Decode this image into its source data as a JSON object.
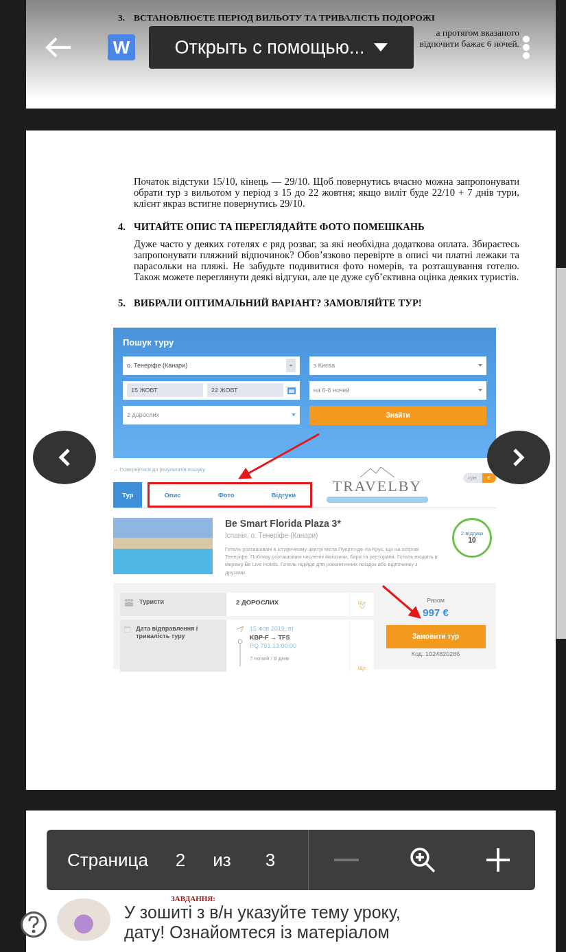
{
  "toolbar": {
    "app_letter": "W",
    "title": "Открыть с помощью..."
  },
  "previous_page": {
    "number": "3.",
    "heading": "ВСТАНОВЛЮЄТЕ ПЕРІОД ВИЛЬОТУ ТА ТРИВАЛІСТЬ ПОДОРОЖІ",
    "fragments": [
      "а протягом вказаного",
      "відпочити  бажає 6 ночей."
    ]
  },
  "document_page": {
    "paragraph": "Початок відстуки 15/10, кінець — 29/10. Щоб повернутись вчасно можна запропонувати обрати тур з вильотом у період з 15 до 22 жовтня; якщо виліт буде 22/10 + 7 днів тури, клієнт якраз встигне повернутись 29/10.",
    "sections": [
      {
        "number": "4.",
        "heading": "ЧИТАЙТЕ ОПИС ТА ПЕРЕГЛЯДАЙТЕ ФОТО ПОМЕШКАНЬ",
        "body": "Дуже часто у деяких готелях є ряд розваг, за які необхідна додаткова оплата. Збираєтесь запропонувати пляжний відпочинок? Обов’язково перевірте в описі чи платні лежаки та парасольки на пляжі. Не забудьте подивитися фото номерів, та розташування готелю. Також можете переглянути деякі відгуки, але це дуже суб’єктивна оцінка деяких туристів."
      },
      {
        "number": "5.",
        "heading": "ВИБРАЛИ ОПТИМАЛЬНИЙ ВАРІАНТ? ЗАМОВЛЯЙТЕ ТУР!"
      }
    ]
  },
  "embedded_screenshot": {
    "search": {
      "title": "Пошук туру",
      "destination": "о. Тенеріфе (Канари)",
      "departure_city": "з Києва",
      "date_from": "15 ЖОВТ",
      "date_to": "22 ЖОВТ",
      "nights": "на 6-8 ночей",
      "tourists": "2 дорослих",
      "button": "Знайти"
    },
    "back_link": "← Повернутися до результатів пошуку",
    "logo": "TRAVELBY",
    "currency": [
      {
        "label": "грн",
        "selected": false
      },
      {
        "label": "€",
        "selected": true
      }
    ],
    "tabs": [
      {
        "label": "Тур",
        "selected": true
      },
      {
        "label": "Опис",
        "selected": false
      },
      {
        "label": "Фото",
        "selected": false
      },
      {
        "label": "Відгуки",
        "selected": false
      }
    ],
    "hotel": {
      "name": "Be Smart Florida Plaza 3*",
      "location": "Іспанія, о. Тенеріфе (Канари)",
      "description": "Готель розташовані в історичному центрі міста Пуерто-де-ла-Крус, що на острові Тенеріфе. Поблизу розташовані численні магазини, бари та ресторани. Готель входить в мережу Be Live Hotels. Готель підійде для романтичних поїздок або відпочинку з друзями.",
      "reviews": "2 відгука",
      "score": "10"
    },
    "tourists_row": {
      "label": "Туристи",
      "value": "2 ДОРОСЛИХ",
      "more": "Ще"
    },
    "date_row": {
      "label": "Дата відправлення і тривалість туру",
      "date": "15 жов 2019, вт",
      "route": "KBP-F → TFS",
      "flight": "PQ 791 13:00:00",
      "duration": "7 ночей / 8 днів",
      "more": "Ще"
    },
    "total": {
      "label": "Разом",
      "price": "997 €",
      "button": "Замовити тур",
      "code": "Код: 1024820286"
    }
  },
  "pager": {
    "label": "Страница",
    "current": "2",
    "of": "из",
    "total": "3",
    "controls": [
      {
        "kind": "minus",
        "disabled": true
      },
      {
        "kind": "zoom",
        "disabled": false
      },
      {
        "kind": "plus",
        "disabled": false
      }
    ]
  },
  "next_page": {
    "task_label": "ЗАВДАННЯ:",
    "lines": [
      "У зошиті з в/н указуйте тему уроку,",
      "дату! Ознайомтеся із матеріалом"
    ]
  }
}
